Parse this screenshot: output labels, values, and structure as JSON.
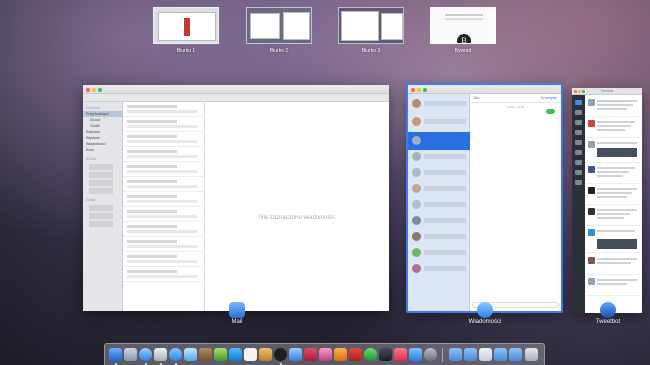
{
  "spaces": [
    {
      "label": "Biurko 1"
    },
    {
      "label": "Biurko 2"
    },
    {
      "label": "Biurko 3"
    },
    {
      "label": "Byword",
      "badge": "B"
    }
  ],
  "mail": {
    "label": "Mail",
    "empty_message": "Nie zaznaczono wiadomości",
    "sidebar_items": [
      {
        "label": "Skrzynki",
        "kind": "section"
      },
      {
        "label": "Przychodzące",
        "kind": "selected"
      },
      {
        "label": "iCloud",
        "kind": "child"
      },
      {
        "label": "Gmail",
        "kind": "child"
      },
      {
        "label": "Robocze",
        "kind": "item"
      },
      {
        "label": "Wysłane",
        "kind": "item"
      },
      {
        "label": "Wiadomości",
        "kind": "item"
      },
      {
        "label": "Kosz",
        "kind": "item"
      },
      {
        "label": "iCloud",
        "kind": "section"
      },
      {
        "label": "Gmail",
        "kind": "section"
      }
    ]
  },
  "messages": {
    "label": "Wiadomości",
    "to": "Do:",
    "details": "Szczegóły",
    "date": "dzisiaj, 14:55"
  },
  "tweetbot": {
    "label": "Tweetbot",
    "title": "Timeline"
  },
  "colors": {
    "accent": "#3b7cf0",
    "imessage_green": "#3fc24a"
  }
}
